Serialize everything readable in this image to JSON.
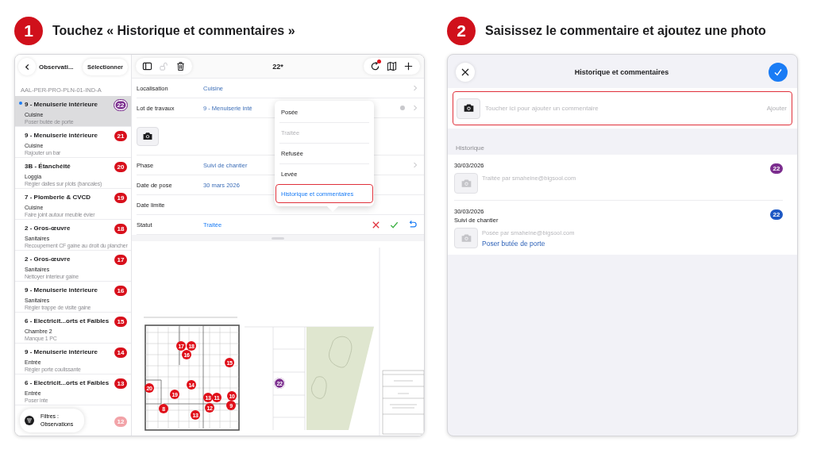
{
  "steps": [
    {
      "number": "1",
      "text": "Touchez « Historique et commentaires »"
    },
    {
      "number": "2",
      "text": "Saisissez le commentaire et ajoutez une photo"
    }
  ],
  "left_screen": {
    "sidebar": {
      "back_label": "Observati...",
      "select_button": "Sélectionner",
      "plan_name": "AAL-PER-PRO-PLN-01-IND-A",
      "items": [
        {
          "title": "9 - Menuiserie intérieure",
          "location": "Cuisine",
          "description": "Poser butée de porte",
          "badge": "22",
          "color": "#7b2d8e",
          "selected": true,
          "unread": true
        },
        {
          "title": "9 - Menuiserie intérieure",
          "location": "Cuisine",
          "description": "Rajouter un bar",
          "badge": "21",
          "color": "#d8101c",
          "selected": false,
          "unread": false
        },
        {
          "title": "3B - Étanchéité",
          "location": "Loggia",
          "description": "Régler dalles sur plots (bancales)",
          "badge": "20",
          "color": "#d8101c",
          "selected": false,
          "unread": false
        },
        {
          "title": "7 - Plomberie & CVCD",
          "location": "Cuisine",
          "description": "Faire joint autour meuble évier",
          "badge": "19",
          "color": "#d8101c",
          "selected": false,
          "unread": false
        },
        {
          "title": "2 - Gros-œuvre",
          "location": "Sanitaires",
          "description": "Recoupement CF gaine au droit du plancher",
          "badge": "18",
          "color": "#d8101c",
          "selected": false,
          "unread": false
        },
        {
          "title": "2 - Gros-œuvre",
          "location": "Sanitaires",
          "description": "Nettoyer interieur gaine",
          "badge": "17",
          "color": "#d8101c",
          "selected": false,
          "unread": false
        },
        {
          "title": "9 - Menuiserie intérieure",
          "location": "Sanitaires",
          "description": "Régler trappe de visite gaine",
          "badge": "16",
          "color": "#d8101c",
          "selected": false,
          "unread": false
        },
        {
          "title": "6 - Electricit...orts et Faibles",
          "location": "Chambre 2",
          "description": "Manque 1 PC",
          "badge": "15",
          "color": "#d8101c",
          "selected": false,
          "unread": false
        },
        {
          "title": "9 - Menuiserie intérieure",
          "location": "Entrée",
          "description": "Régler porte coulissante",
          "badge": "14",
          "color": "#d8101c",
          "selected": false,
          "unread": false
        },
        {
          "title": "6 - Electricit...orts et Faibles",
          "location": "Entrée",
          "description": "Poser inte",
          "badge": "13",
          "color": "#d8101c",
          "selected": false,
          "unread": false
        },
        {
          "badge": "12",
          "color": "#f2a3a8",
          "selected": false,
          "unread": false
        }
      ],
      "filter": {
        "line1": "Filtres :",
        "line2": "Observations"
      }
    },
    "toolbar": {
      "title": "22*",
      "sync_pending": true
    },
    "fields": [
      {
        "kind": "picker",
        "label": "Localisation",
        "value": "Cuisine"
      },
      {
        "kind": "picker-clear",
        "label": "Lot de travaux",
        "value": "9 - Menuiserie inté"
      },
      {
        "kind": "photo"
      },
      {
        "kind": "picker",
        "label": "Phase",
        "value": "Suivi de chantier"
      },
      {
        "kind": "value",
        "label": "Date de pose",
        "value": "30 mars 2026"
      },
      {
        "kind": "value",
        "label": "Date limite"
      },
      {
        "kind": "status",
        "label": "Statut",
        "value": "Traitée"
      }
    ],
    "menu": [
      {
        "label": "Posée",
        "disabled": false,
        "highlighted": false
      },
      {
        "label": "Traitée",
        "disabled": true,
        "highlighted": false
      },
      {
        "label": "Refusée",
        "disabled": false,
        "highlighted": false
      },
      {
        "label": "Levée",
        "disabled": false,
        "highlighted": false
      },
      {
        "label": "Historique et commentaires",
        "disabled": false,
        "highlighted": true
      }
    ],
    "plan": {
      "pins": [
        {
          "label": "17",
          "color": "#e0101a"
        },
        {
          "label": "18",
          "color": "#e0101a"
        },
        {
          "label": "16",
          "color": "#e0101a"
        },
        {
          "label": "15",
          "color": "#e0101a"
        },
        {
          "label": "14",
          "color": "#e0101a"
        },
        {
          "label": "20",
          "color": "#e0101a"
        },
        {
          "label": "19",
          "color": "#e0101a"
        },
        {
          "label": "13",
          "color": "#e0101a"
        },
        {
          "label": "11",
          "color": "#e0101a"
        },
        {
          "label": "10",
          "color": "#e0101a"
        },
        {
          "label": "9",
          "color": "#e0101a"
        },
        {
          "label": "8",
          "color": "#e0101a"
        },
        {
          "label": "12",
          "color": "#e0101a"
        },
        {
          "label": "13",
          "color": "#e0101a"
        },
        {
          "label": "22",
          "color": "#7b2d8e"
        }
      ]
    }
  },
  "right_screen": {
    "title": "Historique et commentaires",
    "comment": {
      "placeholder": "Toucher ici pour ajouter un commentaire",
      "add_button": "Ajouter",
      "highlighted": true
    },
    "history_label": "Historique",
    "entries": [
      {
        "date": "30/03/2026",
        "text": "Traitée par smaheine@bigsool.com",
        "badge": "22",
        "color": "#7b2d8e"
      },
      {
        "date": "30/03/2026",
        "phase": "Suivi de chantier",
        "text": "Posée par smaheine@bigsool.com",
        "link": "Poser butée de porte",
        "badge": "22",
        "color": "#1d58c4"
      }
    ]
  }
}
